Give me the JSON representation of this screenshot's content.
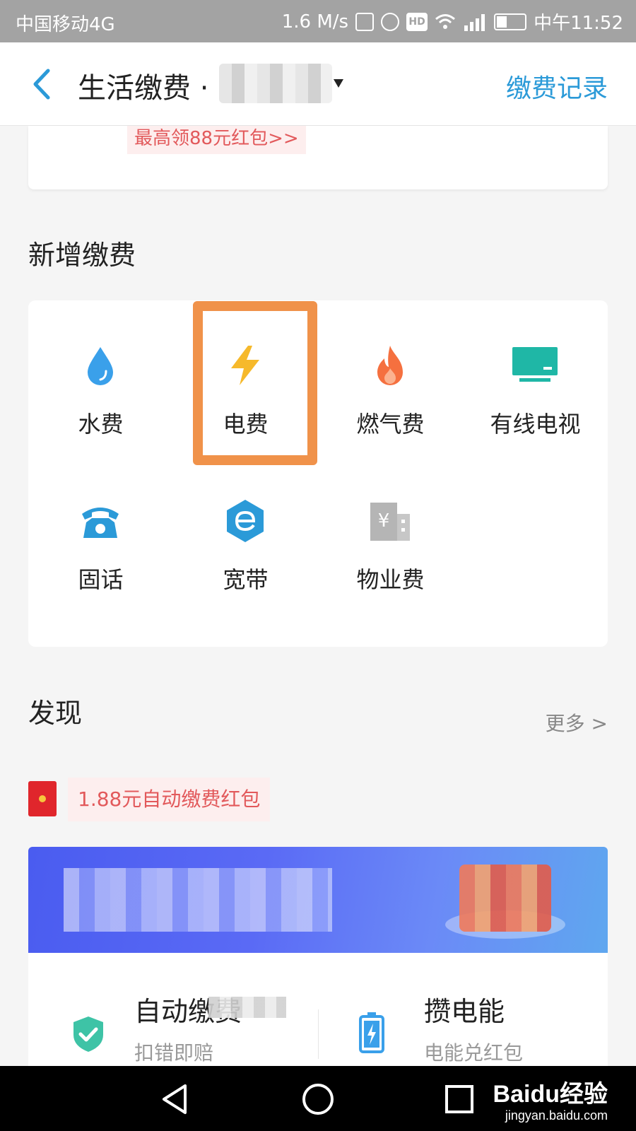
{
  "status_bar": {
    "carrier": "中国移动4G",
    "speed": "1.6 M/s",
    "hd": "HD",
    "time": "中午11:52"
  },
  "header": {
    "title": "生活缴费 ·",
    "records_label": "缴费记录"
  },
  "promo": {
    "text": "最高领88元红包>>"
  },
  "new_payment": {
    "title": "新增缴费",
    "items": [
      {
        "label": "水费",
        "icon": "water-drop-icon"
      },
      {
        "label": "电费",
        "icon": "lightning-icon"
      },
      {
        "label": "燃气费",
        "icon": "flame-icon"
      },
      {
        "label": "有线电视",
        "icon": "tv-icon"
      },
      {
        "label": "固话",
        "icon": "telephone-icon"
      },
      {
        "label": "宽带",
        "icon": "broadband-icon"
      },
      {
        "label": "物业费",
        "icon": "building-icon"
      }
    ],
    "highlight_color": "#f0924a"
  },
  "discover": {
    "title": "发现",
    "more_label": "更多 >",
    "red_packet_text": "1.88元自动缴费红包",
    "cards": [
      {
        "title": "自动缴费",
        "subtitle": "扣错即赔",
        "icon": "shield-check-icon"
      },
      {
        "title": "攒电能",
        "subtitle": "电能兑红包",
        "icon": "battery-icon"
      }
    ]
  },
  "watermark": {
    "brand": "Baidu经验",
    "url": "jingyan.baidu.com"
  },
  "colors": {
    "accent": "#2b9ad8",
    "promo_red": "#e2595b"
  }
}
